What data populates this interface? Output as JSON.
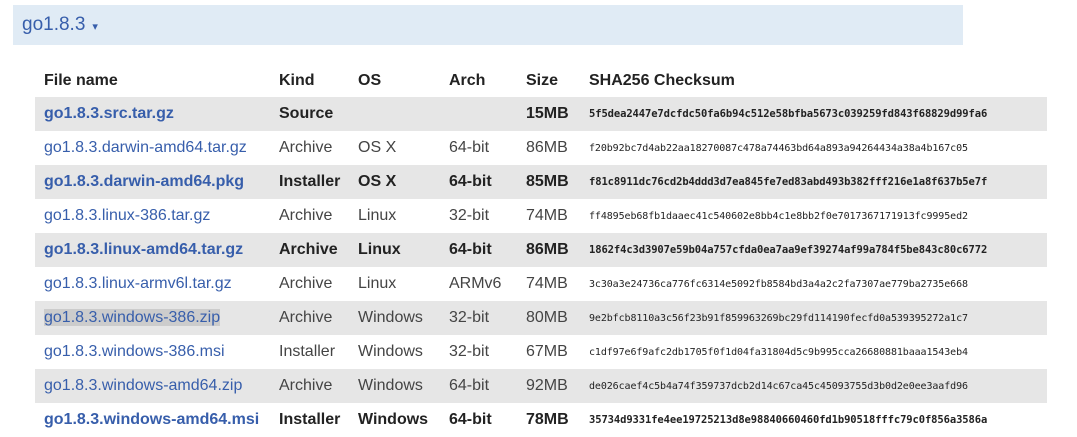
{
  "version": {
    "label": "go1.8.3",
    "caret": "▾"
  },
  "table": {
    "headers": [
      "File name",
      "Kind",
      "OS",
      "Arch",
      "Size",
      "SHA256 Checksum"
    ],
    "rows": [
      {
        "file": "go1.8.3.src.tar.gz",
        "kind": "Source",
        "os": "",
        "arch": "",
        "size": "15MB",
        "checksum": "5f5dea2447e7dcfdc50fa6b94c512e58bfba5673c039259fd843f68829d99fa6",
        "highlight": true
      },
      {
        "file": "go1.8.3.darwin-amd64.tar.gz",
        "kind": "Archive",
        "os": "OS X",
        "arch": "64-bit",
        "size": "86MB",
        "checksum": "f20b92bc7d4ab22aa18270087c478a74463bd64a893a94264434a38a4b167c05",
        "highlight": false
      },
      {
        "file": "go1.8.3.darwin-amd64.pkg",
        "kind": "Installer",
        "os": "OS X",
        "arch": "64-bit",
        "size": "85MB",
        "checksum": "f81c8911dc76cd2b4ddd3d7ea845fe7ed83abd493b382fff216e1a8f637b5e7f",
        "highlight": true
      },
      {
        "file": "go1.8.3.linux-386.tar.gz",
        "kind": "Archive",
        "os": "Linux",
        "arch": "32-bit",
        "size": "74MB",
        "checksum": "ff4895eb68fb1daaec41c540602e8bb4c1e8bb2f0e7017367171913fc9995ed2",
        "highlight": false
      },
      {
        "file": "go1.8.3.linux-amd64.tar.gz",
        "kind": "Archive",
        "os": "Linux",
        "arch": "64-bit",
        "size": "86MB",
        "checksum": "1862f4c3d3907e59b04a757cfda0ea7aa9ef39274af99a784f5be843c80c6772",
        "highlight": true
      },
      {
        "file": "go1.8.3.linux-armv6l.tar.gz",
        "kind": "Archive",
        "os": "Linux",
        "arch": "ARMv6",
        "size": "74MB",
        "checksum": "3c30a3e24736ca776fc6314e5092fb8584bd3a4a2c2fa7307ae779ba2735e668",
        "highlight": false
      },
      {
        "file": "go1.8.3.windows-386.zip",
        "kind": "Archive",
        "os": "Windows",
        "arch": "32-bit",
        "size": "80MB",
        "checksum": "9e2bfcb8110a3c56f23b91f859963269bc29fd114190fecfd0a539395272a1c7",
        "highlight": false,
        "selected": true
      },
      {
        "file": "go1.8.3.windows-386.msi",
        "kind": "Installer",
        "os": "Windows",
        "arch": "32-bit",
        "size": "67MB",
        "checksum": "c1df97e6f9afc2db1705f0f1d04fa31804d5c9b995cca26680881baaa1543eb4",
        "highlight": false
      },
      {
        "file": "go1.8.3.windows-amd64.zip",
        "kind": "Archive",
        "os": "Windows",
        "arch": "64-bit",
        "size": "92MB",
        "checksum": "de026caef4c5b4a74f359737dcb2d14c67ca45c45093755d3b0d2e0ee3aafd96",
        "highlight": false
      },
      {
        "file": "go1.8.3.windows-amd64.msi",
        "kind": "Installer",
        "os": "Windows",
        "arch": "64-bit",
        "size": "78MB",
        "checksum": "35734d9331fe4ee19725213d8e98840660460fd1b90518fffc79c0f856a3586a",
        "highlight": true
      }
    ]
  },
  "colors": {
    "link": "#375eab",
    "version_bar_bg": "#e0ebf5",
    "row_alt_bg": "#e6e6e6",
    "selected_bg": "#cccccc"
  }
}
